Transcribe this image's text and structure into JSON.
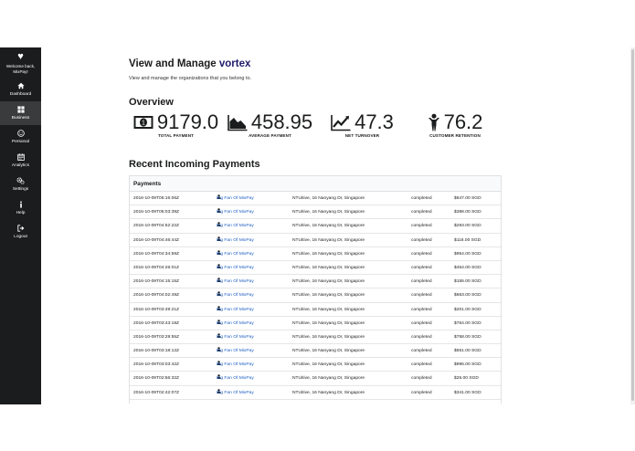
{
  "sidebar": {
    "welcome_line1": "Welcome back,",
    "welcome_line2": "MixPay!",
    "items": [
      {
        "label": "Dashboard",
        "icon": "home-icon"
      },
      {
        "label": "Business",
        "icon": "grid-icon",
        "active": true
      },
      {
        "label": "Personal",
        "icon": "smile-icon"
      },
      {
        "label": "Analytics",
        "icon": "calendar-icon"
      },
      {
        "label": "Settings",
        "icon": "gears-icon"
      },
      {
        "label": "Help",
        "icon": "info-icon"
      },
      {
        "label": "Logout",
        "icon": "sign-out-icon"
      }
    ]
  },
  "header": {
    "title_prefix": "View and Manage",
    "org_name": "vortex",
    "subtitle": "View and manage the organizations that you belong to."
  },
  "overview": {
    "heading": "Overview",
    "stats": [
      {
        "value": "9179.0",
        "label": "TOTAL PAYMENT",
        "icon": "money-icon"
      },
      {
        "value": "458.95",
        "label": "AVERAGE PAYMENT",
        "icon": "area-chart-icon"
      },
      {
        "value": "47.3",
        "label": "NET TURNOVER",
        "icon": "line-chart-icon"
      },
      {
        "value": "76.2",
        "label": "CUSTOMER RETENTION",
        "icon": "person-icon"
      }
    ]
  },
  "payments": {
    "heading": "Recent Incoming Payments",
    "table_title": "Payments",
    "rows": [
      {
        "time": "2016-10-09T05:15:06Z",
        "user": "Big Fan Of MixPay",
        "address": "NTUitive, 16 Nanyang Dr, Singapore",
        "status": "completed",
        "amount": "$647.00 SGD"
      },
      {
        "time": "2016-10-09T05:03:39Z",
        "user": "Big Fan Of MixPay",
        "address": "NTUitive, 16 Nanyang Dr, Singapore",
        "status": "completed",
        "amount": "$388.00 SGD"
      },
      {
        "time": "2016-10-09T04:52:22Z",
        "user": "Big Fan Of MixPay",
        "address": "NTUitive, 16 Nanyang Dr, Singapore",
        "status": "completed",
        "amount": "$293.00 SGD"
      },
      {
        "time": "2016-10-09T04:46:44Z",
        "user": "Big Fan Of MixPay",
        "address": "NTUitive, 16 Nanyang Dr, Singapore",
        "status": "completed",
        "amount": "$116.00 SGD"
      },
      {
        "time": "2016-10-09T04:34:59Z",
        "user": "Big Fan Of MixPay",
        "address": "NTUitive, 16 Nanyang Dr, Singapore",
        "status": "completed",
        "amount": "$954.00 SGD"
      },
      {
        "time": "2016-10-09T04:26:01Z",
        "user": "Big Fan Of MixPay",
        "address": "NTUitive, 16 Nanyang Dr, Singapore",
        "status": "completed",
        "amount": "$454.00 SGD"
      },
      {
        "time": "2016-10-09T04:15:15Z",
        "user": "Big Fan Of MixPay",
        "address": "NTUitive, 16 Nanyang Dr, Singapore",
        "status": "completed",
        "amount": "$155.00 SGD"
      },
      {
        "time": "2016-10-09T04:02:49Z",
        "user": "Big Fan Of MixPay",
        "address": "NTUitive, 16 Nanyang Dr, Singapore",
        "status": "completed",
        "amount": "$663.00 SGD"
      },
      {
        "time": "2016-10-09T03:49:21Z",
        "user": "Big Fan Of MixPay",
        "address": "NTUitive, 16 Nanyang Dr, Singapore",
        "status": "completed",
        "amount": "$201.00 SGD"
      },
      {
        "time": "2016-10-09T03:43:19Z",
        "user": "Big Fan Of MixPay",
        "address": "NTUitive, 16 Nanyang Dr, Singapore",
        "status": "completed",
        "amount": "$764.00 SGD"
      },
      {
        "time": "2016-10-09T03:29:55Z",
        "user": "Big Fan Of MixPay",
        "address": "NTUitive, 16 Nanyang Dr, Singapore",
        "status": "completed",
        "amount": "$758.00 SGD"
      },
      {
        "time": "2016-10-09T03:18:12Z",
        "user": "Big Fan Of MixPay",
        "address": "NTUitive, 16 Nanyang Dr, Singapore",
        "status": "completed",
        "amount": "$551.00 SGD"
      },
      {
        "time": "2016-10-09T03:03:42Z",
        "user": "Big Fan Of MixPay",
        "address": "NTUitive, 16 Nanyang Dr, Singapore",
        "status": "completed",
        "amount": "$996.00 SGD"
      },
      {
        "time": "2016-10-09T02:56:32Z",
        "user": "Big Fan Of MixPay",
        "address": "NTUitive, 16 Nanyang Dr, Singapore",
        "status": "completed",
        "amount": "$25.00 SGD"
      },
      {
        "time": "2016-10-09T02:42:07Z",
        "user": "Big Fan Of MixPay",
        "address": "NTUitive, 16 Nanyang Dr, Singapore",
        "status": "completed",
        "amount": "$341.00 SGD"
      }
    ]
  },
  "colors": {
    "sidebar_bg": "#1b1c1d",
    "org_name": "#1f1b6b",
    "link": "#2160c4"
  }
}
